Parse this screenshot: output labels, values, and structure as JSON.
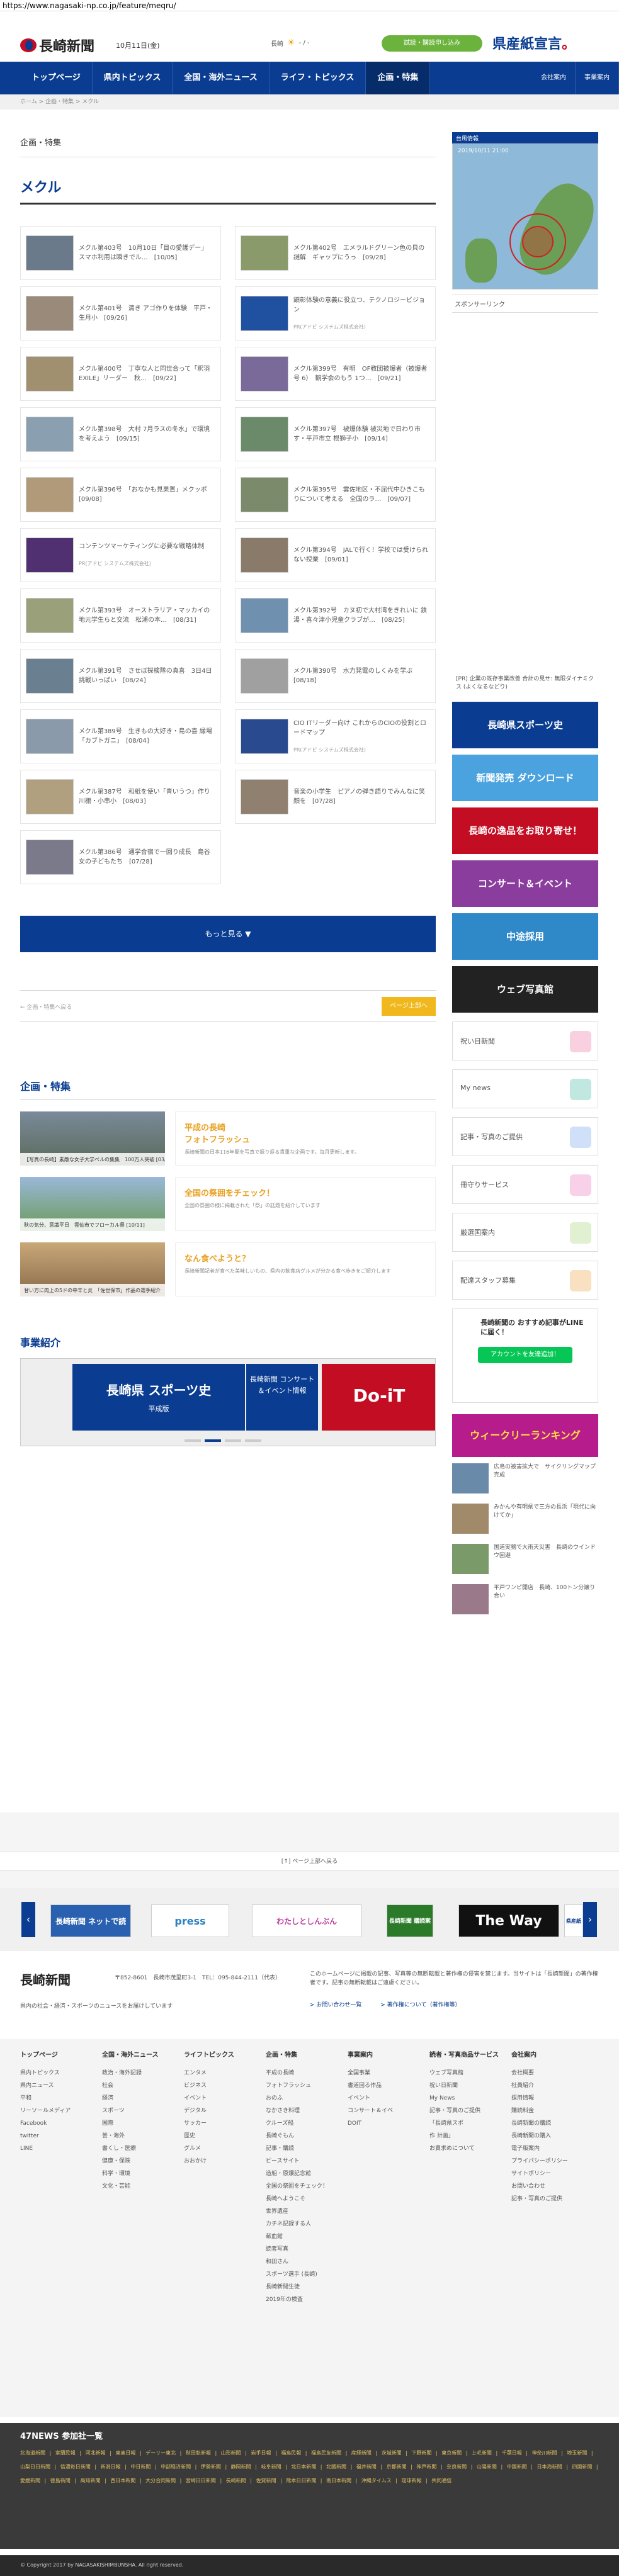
{
  "url": "https://www.nagasaki-np.co.jp/feature/meqru/",
  "header": {
    "logo_text": "長崎新聞",
    "date": "10月11日(金)",
    "weather_label": "長崎",
    "weather_text": "- / -",
    "trial_label": "試読・購読申し込み",
    "kenban_text": "県産紙宣言",
    "kenban_suffix": "。"
  },
  "nav": {
    "items": [
      "トップページ",
      "県内トピックス",
      "全国・海外ニュース",
      "ライフ・トピックス",
      "企画・特集"
    ],
    "right_items": [
      "会社案内",
      "事業案内"
    ]
  },
  "breadcrumb": "ホーム > 企画・特集 > メクル",
  "section_label": "企画・特集",
  "page_title": "メクル",
  "cards": [
    {
      "title": "メクル第403号　10月10日「目の愛護デー」　スマホ利用は瞬きでル…　[10/05]",
      "pr": ""
    },
    {
      "title": "メクル第402号　エメラルドグリーン色の貝の謎解　ギャップにうっ　[09/28]",
      "pr": ""
    },
    {
      "title": "メクル第401号　清き アゴ作りを体験　平戸・生月小　[09/26]",
      "pr": ""
    },
    {
      "title": "顕彰体験の意義に役立つ、テクノロジービジョン",
      "pr": "PR(アドビ システムズ株式会社)"
    },
    {
      "title": "メクル第400号　丁寧な人と同世合って「釈羽EXILE」リーダー　秋…　[09/22]",
      "pr": ""
    },
    {
      "title": "メクル第399号　有明　OF教団被爆者（被爆者号 6）　観学会のもう 1つ…　[09/21]",
      "pr": ""
    },
    {
      "title": "メクル第398号　大村 7月ラスの冬水」で環境を考えよう　[09/15]",
      "pr": ""
    },
    {
      "title": "メクル第397号　被爆体験 被災地で日わり市す・平戸市立 根獅子小　[09/14]",
      "pr": ""
    },
    {
      "title": "メクル第396号　「おなかも見果置」メクッポ　[09/08]",
      "pr": ""
    },
    {
      "title": "メクル第395号　雲佐地区・不屈代中ひきこもりについて考える　全国のラ…　[09/07]",
      "pr": ""
    },
    {
      "title": "コンテンツマーケティングに必要な戦略体制",
      "pr": "PR(アドビ システムズ株式会社)"
    },
    {
      "title": "メクル第394号　JALで行く！学校では受けられない授業　[09/01]",
      "pr": ""
    },
    {
      "title": "メクル第393号　オーストラリア・マッカイの地元学生らと交流　松浦の本…　[08/31]",
      "pr": ""
    },
    {
      "title": "メクル第392号　カヌ初で大村湾をきれいに 鉄湯・喜々津小児童クラブが…　[08/25]",
      "pr": ""
    },
    {
      "title": "メクル第391号　させぼ探検隊の真喜　3日4日　挑戦いっぱい　[08/24]",
      "pr": ""
    },
    {
      "title": "メクル第390号　水力発電のしくみを学ぶ　[08/18]",
      "pr": ""
    },
    {
      "title": "メクル第389号　生きもの大好き・島の喜 縁場「カブトガニ」　[08/04]",
      "pr": ""
    },
    {
      "title": "CIO ITリーダー向け これからのCIOの役割とロードマップ",
      "pr": "PR(アドビ システムズ株式会社)"
    },
    {
      "title": "メクル第387号　和紙を使い「青いうつ」作り　川棚・小串小　[08/03]",
      "pr": ""
    },
    {
      "title": "音楽の小学生　ピアノの弾き語りでみんなに笑顔を　[07/28]",
      "pr": ""
    },
    {
      "title": "メクル第386号　通学合宿で一回り成長　島谷女の子どもたち　[07/28]",
      "pr": ""
    }
  ],
  "more_label": "もっと見る ▼",
  "pager": {
    "back": "← 企画・特集へ戻る",
    "top": "ページ上部へ"
  },
  "feature": {
    "title": "企画・特集",
    "items": [
      {
        "caption": "【写真の長崎】素敵な女子大学ペルの集集　100万人突破 [03/17]",
        "head": "平成の長崎",
        "sub": "フォトフラッシュ",
        "desc": "長崎新聞の日本116年間を写真で振り返る貴重な企画です。毎月更新します。"
      },
      {
        "caption": "秋の気分、意識平日　雲仙市でフローカル祭 [10/11]",
        "head": "全国の祭囲をチェック！",
        "sub": "",
        "desc": "全国の祭囲の様に掲載された「祭」の話題を紹介しています"
      },
      {
        "caption": "甘い方に肉上の5ドの中辛と炎　「佐世保市」作品の選手紹介　壱岐市大会 in 五島ドワン・メルグ [10/07]",
        "head": "なん食べようと？",
        "sub": "",
        "desc": "長崎新聞記者が食べた美味しいもの、県内の飲食店グルメが分かる食べ歩きをご紹介します"
      }
    ]
  },
  "business": {
    "title": "事業紹介",
    "p1": "長崎県 スポーツ史",
    "p1_sub": "平成版",
    "p2": "長崎新聞 コンサート ＆イベント情報",
    "p3": "Do-iT"
  },
  "side": {
    "map_head": "台風情報",
    "map_stamp": "2019/10/11 21:00",
    "sponsor": "スポンサーリンク",
    "pr_link": "[PR] 企業の既存事業改善 合計の見せ: 無限ダイナミクス (よくなるなどり)",
    "banners": [
      {
        "label": "長崎県スポーツ史",
        "color": "#0a3d91"
      },
      {
        "label": "新聞発売 ダウンロード",
        "color": "#4aa3df"
      },
      {
        "label": "長崎の逸品をお取り寄せ！",
        "color": "#c30d23"
      },
      {
        "label": "コンサート＆イベント",
        "color": "#8b3d9e"
      },
      {
        "label": "中途採用",
        "color": "#2f88c8"
      },
      {
        "label": "ウェブ写真館",
        "color": "#222222"
      }
    ],
    "tiles": [
      "祝い日新聞",
      "My news",
      "記事・写真のご提供",
      "冊守りサービス",
      "厳選国案内",
      "配達スタッフ募集"
    ],
    "line_text": "長崎新聞の おすすめ記事がLINEに届く！",
    "line_btn": "アカウントを友達追加！",
    "ranking": "ウィークリーランキング",
    "rank_items": [
      "広島の被害拡大で　サイクリングマップ完成",
      "みかんや有明県で三方の長浜「現代に向けてか」",
      "国道実務で大雨天災害　長崎のウインドウ回避",
      "平戸ワンピ開店　長崎、100トン分譲り合い"
    ]
  },
  "gotop": "[↑] ページ上部へ戻る",
  "carousel": [
    "長崎新聞 ネットで読",
    "press",
    "わたしとしんぶん",
    "長崎新聞 購読案内",
    "The Way",
    "県産紙宣言"
  ],
  "footer": {
    "logo": "長崎新聞",
    "addr": "〒852-8601　長崎市茂里町3-1　TEL：095-844-2111（代表）",
    "tagline": "県内の社会・経済・スポーツのニュースをお届けしています",
    "notice": "このホームページに掲載の記事、写真等の無断転載と著作権の侵害を禁じます。当サイトは「長崎新聞」の著作権者です。記事の無断転載はご遠慮ください。",
    "link1": "> お問い合わせ一覧",
    "link2": "> 著作権について（著作権等）"
  },
  "sitemap": [
    {
      "head": "トップページ",
      "items": [
        "県内トピックス",
        "県内ニュース",
        "平和",
        "リーソールメディア",
        "Facebook",
        "twitter",
        "LINE"
      ]
    },
    {
      "head": "全国・海外ニュース",
      "items": [
        "政治・海外記録",
        "社会",
        "経済",
        "スポーツ",
        "国際",
        "芸・海外",
        "書くし・医療",
        "健康・保険",
        "科学・環境",
        "文化・芸能"
      ]
    },
    {
      "head": "ライフトピックス",
      "items": [
        "エンタメ",
        "ビジネス",
        "イベント",
        "デジタル",
        "サッカー",
        "歴史",
        "グルメ",
        "おおかけ"
      ]
    },
    {
      "head": "企画・特集",
      "items": [
        "平成の長崎",
        "フォトフラッシュ",
        "おのふ",
        "なかさき料理",
        "クルーズ船",
        "長崎ぐもん",
        "記事・購読",
        "ピースサイト",
        "造船・原爆記念館",
        "全国の祭囲をチェック！",
        "長崎へようこそ",
        "世界遺産",
        "カチネ記録する人",
        "献血館",
        "読者写真",
        "和田さん",
        "スポーツ選手 (長崎)",
        "長崎新聞生徒",
        "2019年の検査"
      ]
    },
    {
      "head": "事業案内",
      "items": [
        "全国事業",
        "書道回る作品",
        "イベント",
        "コンサート＆イベ",
        "DOIT"
      ]
    },
    {
      "head": "読者・写真商品サービス",
      "items": [
        "ウェブ写真館",
        "祝い日新聞",
        "My News",
        "記事・写真のご提供",
        "「長崎県スポ",
        "作 計画」",
        "お買求めについて"
      ]
    },
    {
      "head": "会社案内",
      "items": [
        "会社概要",
        "社員紹介",
        "採用情報",
        "購読料金",
        "長崎新聞の購読",
        "長崎新聞の購入",
        "電子版案内",
        "プライバシーポリシー",
        "サイトポリシー",
        "お問い合わせ",
        "記事・写真のご提供"
      ]
    }
  ],
  "n47": {
    "head": "47NEWS 参加社一覧",
    "list": "北海道新聞 | 室蘭民報 | 河北新報 | 東奥日報 | デーリー東北 | 秋田魁新報 | 山形新聞 | 岩手日報 | 福島民報 | 福島民友新聞 | 産経新聞 | 茨城新聞 | 下野新聞 | 東京新聞 | 上毛新聞 | 千葉日報 | 神奈川新聞 | 埼玉新聞 | 山梨日日新聞 | 信濃毎日新聞 | 新潟日報 | 中日新聞 | 中部経済新聞 | 伊勢新聞 | 静岡新聞 | 岐阜新聞 | 北日本新聞 | 北國新聞 | 福井新聞 | 京都新聞 | 神戸新聞 | 奈良新聞 | 山陽新聞 | 中国新聞 | 日本海新聞 | 四国新聞 | 愛媛新聞 | 徳島新聞 | 高知新聞 | 西日本新聞 | 大分合同新聞 | 宮崎日日新聞 | 長崎新聞 | 佐賀新聞 | 熊本日日新聞 | 南日本新聞 | 沖縄タイムス | 琉球新報 | 共同通信"
  },
  "copyright": "© Copyright 2017 by NAGASAKISHIMBUNSHA. All right reserved."
}
